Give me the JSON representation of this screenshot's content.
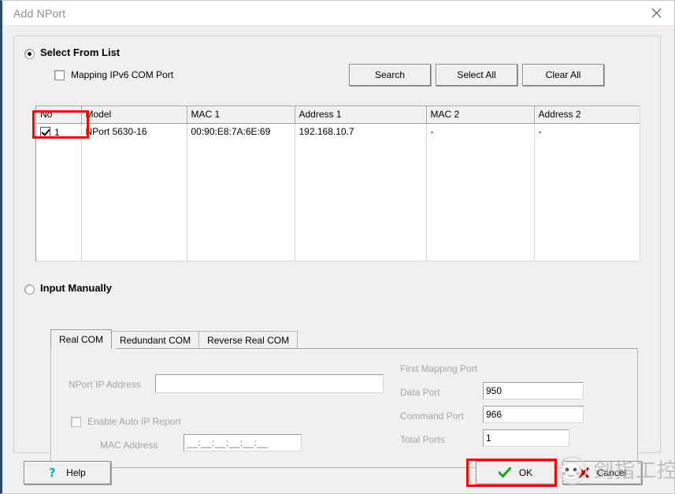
{
  "window": {
    "title": "Add NPort",
    "close_icon": "close-icon"
  },
  "select_from_list": {
    "radio_label": "Select From List",
    "radio_checked": true,
    "mapping_ipv6_label": "Mapping IPv6 COM Port",
    "mapping_ipv6_checked": false,
    "buttons": {
      "search": "Search",
      "select_all": "Select All",
      "clear_all": "Clear All"
    },
    "table": {
      "columns": [
        "No",
        "Model",
        "MAC 1",
        "Address 1",
        "MAC 2",
        "Address 2",
        ""
      ],
      "rows": [
        {
          "checked": true,
          "no": "1",
          "model": "NPort 5630-16",
          "mac1": "00:90:E8:7A:6E:69",
          "address1": "192.168.10.7",
          "mac2": "-",
          "address2": "-",
          "extra": ""
        }
      ],
      "empty_row_count": 7
    }
  },
  "input_manually": {
    "radio_label": "Input Manually",
    "radio_checked": false,
    "tabs": [
      {
        "label": "Real COM",
        "active": true
      },
      {
        "label": "Redundant COM",
        "active": false
      },
      {
        "label": "Reverse Real COM",
        "active": false
      }
    ],
    "form": {
      "nport_ip_label": "NPort IP Address",
      "nport_ip_value": "",
      "enable_auto_ip_label": "Enable Auto IP Report",
      "enable_auto_ip_checked": false,
      "mac_address_label": "MAC Address",
      "mac_address_value": "__:__:__:__:__:__",
      "first_mapping_port_label": "First Mapping Port",
      "data_port_label": "Data Port",
      "data_port_value": "950",
      "command_port_label": "Command Port",
      "command_port_value": "966",
      "total_ports_label": "Total Ports",
      "total_ports_value": "1"
    }
  },
  "footer": {
    "help_label": "Help",
    "help_icon": "question-mark-icon",
    "ok_label": "OK",
    "ok_icon": "check-mark-icon",
    "cancel_label": "Cancel",
    "cancel_icon": "x-mark-icon"
  },
  "annotations": {
    "highlight_color": "#ff0000",
    "boxes": [
      {
        "name": "row-checkbox-highlight"
      },
      {
        "name": "ok-button-highlight"
      }
    ]
  },
  "watermark": {
    "text": "剑指工控"
  },
  "colors": {
    "dialog_bg": "#f0f0f0",
    "title_text": "#8c8c99",
    "accent_left_border": "#2b4a6b",
    "disabled_text": "#a6a6a6",
    "ok_check": "#17a317",
    "cancel_x": "#b40000",
    "help_question": "#1aa6ad"
  }
}
